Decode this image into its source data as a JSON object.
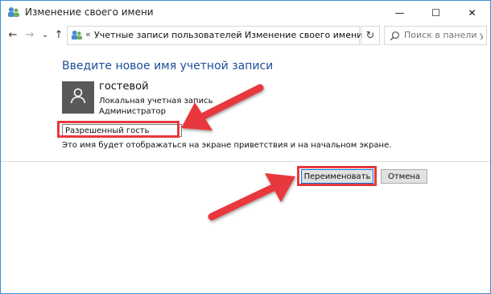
{
  "window": {
    "title": "Изменение своего имени",
    "minimize_symbol": "—",
    "maximize_symbol": "☐",
    "close_symbol": "✕"
  },
  "nav": {
    "back_symbol": "←",
    "forward_symbol": "→",
    "recent_symbol": "⌄",
    "up_symbol": "↑",
    "overflow": "«",
    "breadcrumbs": [
      "Учетные записи пользователей",
      "Изменение своего имени"
    ],
    "breadcrumb_separator": "›",
    "dropdown_symbol": "⌄",
    "refresh_symbol": "↻",
    "search_placeholder": "Поиск в панели упр..."
  },
  "content": {
    "heading": "Введите новое имя учетной записи",
    "user": {
      "name": "гостевой",
      "account_type": "Локальная учетная запись",
      "role": "Администратор"
    },
    "new_name_value": "Разрешенный гость",
    "hint": "Это имя будет отображаться на экране приветствия и на начальном экране.",
    "rename_button": "Переименовать",
    "cancel_button": "Отмена"
  },
  "colors": {
    "heading": "#1e4d9b",
    "annotation": "#e8383d",
    "window_border": "#3c8fd6"
  }
}
